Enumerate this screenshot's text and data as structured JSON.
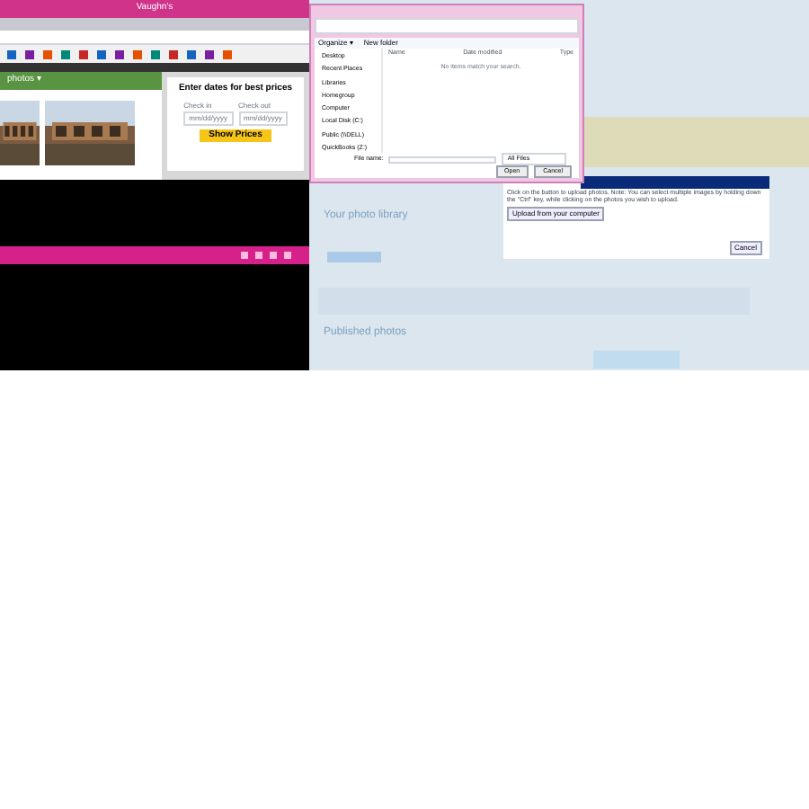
{
  "left_browser": {
    "title": "Vaughn's",
    "section_tab": "photos ▾",
    "booking": {
      "heading": "Enter dates for best prices",
      "check_in_label": "Check in",
      "check_out_label": "Check out",
      "check_in_value": "mm/dd/yyyy",
      "check_out_value": "mm/dd/yyyy",
      "button": "Show Prices"
    }
  },
  "file_dialog": {
    "toolbar": [
      "Organize ▾",
      "New folder"
    ],
    "columns": [
      "Name",
      "Date modified",
      "Type"
    ],
    "empty_message": "No items match your search.",
    "nav": [
      {
        "label": "Desktop"
      },
      {
        "label": "Recent Places"
      },
      {
        "label": "Libraries"
      },
      {
        "label": "Homegroup"
      },
      {
        "label": "Computer"
      },
      {
        "label": "Local Disk (C:)"
      },
      {
        "label": "Public (\\\\DELL)"
      },
      {
        "label": "QuickBooks (Z:)"
      }
    ],
    "file_name_label": "File name:",
    "file_type": "All Files",
    "buttons": [
      "Open",
      "Cancel"
    ]
  },
  "upload_dialog": {
    "instruction": "Click on the button to upload photos. Note: You can select multiple images by holding down the \"Ctrl\" key, while clicking on the photos you wish to upload.",
    "upload_button": "Upload from your computer",
    "cancel": "Cancel"
  },
  "page": {
    "library_title": "Your photo library",
    "published_title": "Published photos"
  }
}
